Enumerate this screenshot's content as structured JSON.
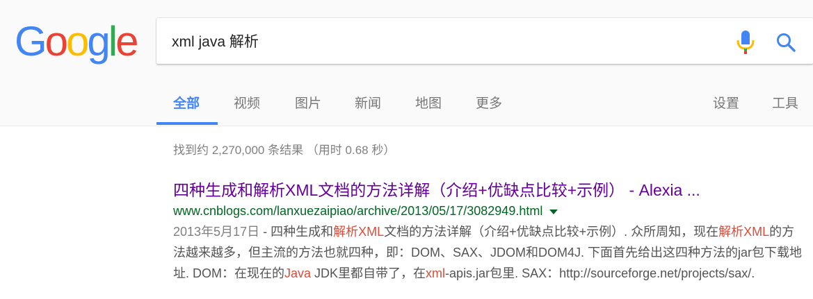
{
  "logo": {
    "letters": [
      "G",
      "o",
      "o",
      "g",
      "l",
      "e"
    ],
    "colors": [
      "#4285f4",
      "#ea4335",
      "#fbbc05",
      "#4285f4",
      "#34a853",
      "#ea4335"
    ]
  },
  "search": {
    "query": "xml java 解析",
    "mic_icon": "microphone-icon",
    "search_icon": "magnifier-icon"
  },
  "tabs": [
    {
      "label": "全部",
      "active": true
    },
    {
      "label": "视频"
    },
    {
      "label": "图片"
    },
    {
      "label": "新闻"
    },
    {
      "label": "地图"
    },
    {
      "label": "更多"
    }
  ],
  "tools": {
    "settings": "设置",
    "tools": "工具"
  },
  "stats": "找到约 2,270,000 条结果 （用时 0.68 秒）",
  "results": [
    {
      "title": "四种生成和解析XML文档的方法详解（介绍+优缺点比较+示例） - Alexia ...",
      "url": "www.cnblogs.com/lanxuezaipiao/archive/2013/05/17/3082949.html",
      "date": "2013年5月17日",
      "snippet": [
        {
          "t": " - 四种生成和"
        },
        {
          "t": "解析",
          "hl": true
        },
        {
          "t": "XML",
          "hl": true
        },
        {
          "t": "文档的方法详解（介绍+优缺点比较+示例）. 众所周知，现在"
        },
        {
          "t": "解析",
          "hl": true
        },
        {
          "t": "XML",
          "hl": true
        },
        {
          "t": "的方法越来越多，但主流的方法也就四种，即：DOM、SAX、JDOM和DOM4J. 下面首先给出这四种方法的jar包下载地址. DOM：在现在的"
        },
        {
          "t": "Java",
          "hl": true
        },
        {
          "t": " JDK里都自带了，在"
        },
        {
          "t": "xml",
          "hl": true
        },
        {
          "t": "-apis.jar包里. SAX：http://sourceforge.net/projects/sax/."
        }
      ]
    }
  ],
  "colors": {
    "accent": "#4285f4",
    "title_visited": "#660099",
    "url_green": "#006621",
    "highlight_red": "#dd4b39"
  }
}
